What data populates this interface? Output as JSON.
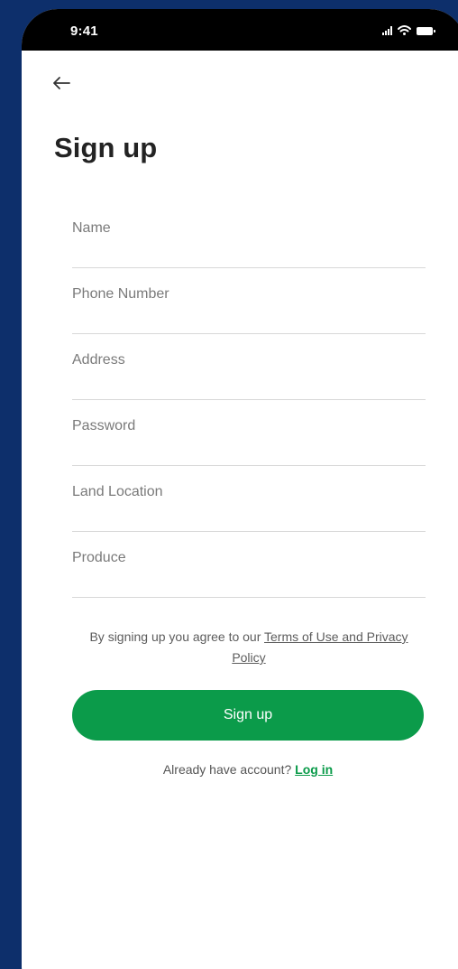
{
  "status": {
    "time": "9:41"
  },
  "header": {
    "back_icon": "arrow-left-icon",
    "title": "Sign up"
  },
  "form": {
    "fields": [
      {
        "placeholder": "Name",
        "value": ""
      },
      {
        "placeholder": "Phone Number",
        "value": ""
      },
      {
        "placeholder": "Address",
        "value": ""
      },
      {
        "placeholder": "Password",
        "value": ""
      },
      {
        "placeholder": "Land Location",
        "value": ""
      },
      {
        "placeholder": "Produce",
        "value": ""
      }
    ]
  },
  "legal": {
    "prefix": "By signing up you agree to our ",
    "link": "Terms of Use and Privacy Policy"
  },
  "actions": {
    "signup_label": "Sign up",
    "login_prompt": "Already have account? ",
    "login_label": "Log in"
  },
  "colors": {
    "background": "#0d2f6b",
    "accent": "#0b9b4a",
    "title": "#232323"
  }
}
